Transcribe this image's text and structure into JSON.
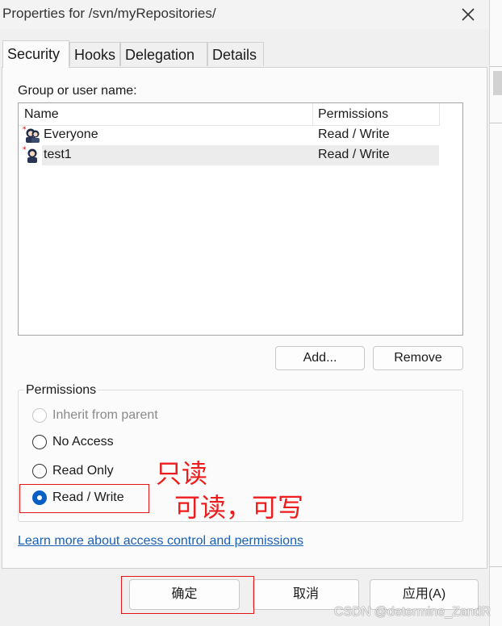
{
  "window": {
    "title": "Properties for /svn/myRepositories/"
  },
  "tabs": [
    {
      "label": "Security",
      "active": true
    },
    {
      "label": "Hooks"
    },
    {
      "label": "Delegation"
    },
    {
      "label": "Details"
    }
  ],
  "security": {
    "group_label": "Group or user name:",
    "columns": {
      "name": "Name",
      "permissions": "Permissions"
    },
    "users": [
      {
        "name": "Everyone",
        "permission": "Read / Write",
        "icon": "user-group-icon"
      },
      {
        "name": "test1",
        "permission": "Read / Write",
        "icon": "user-icon",
        "selected": true
      }
    ],
    "add_button": "Add...",
    "remove_button": "Remove",
    "permissions_group": "Permissions",
    "options": [
      {
        "label": "Inherit from parent",
        "disabled": true
      },
      {
        "label": "No Access"
      },
      {
        "label": "Read Only"
      },
      {
        "label": "Read / Write",
        "checked": true
      }
    ],
    "link": "Learn more about access control and permissions"
  },
  "annotations": {
    "read_only_note": "只读",
    "read_write_note": "可读，可写",
    "color": "#ee1c1c"
  },
  "footer": {
    "ok": "确定",
    "cancel": "取消",
    "apply": "应用(A)"
  },
  "watermark": "CSDN @determine_ZandR",
  "colors": {
    "accent": "#0a5fc5",
    "link": "#1a5fb4",
    "highlight_box": "#e21515"
  }
}
